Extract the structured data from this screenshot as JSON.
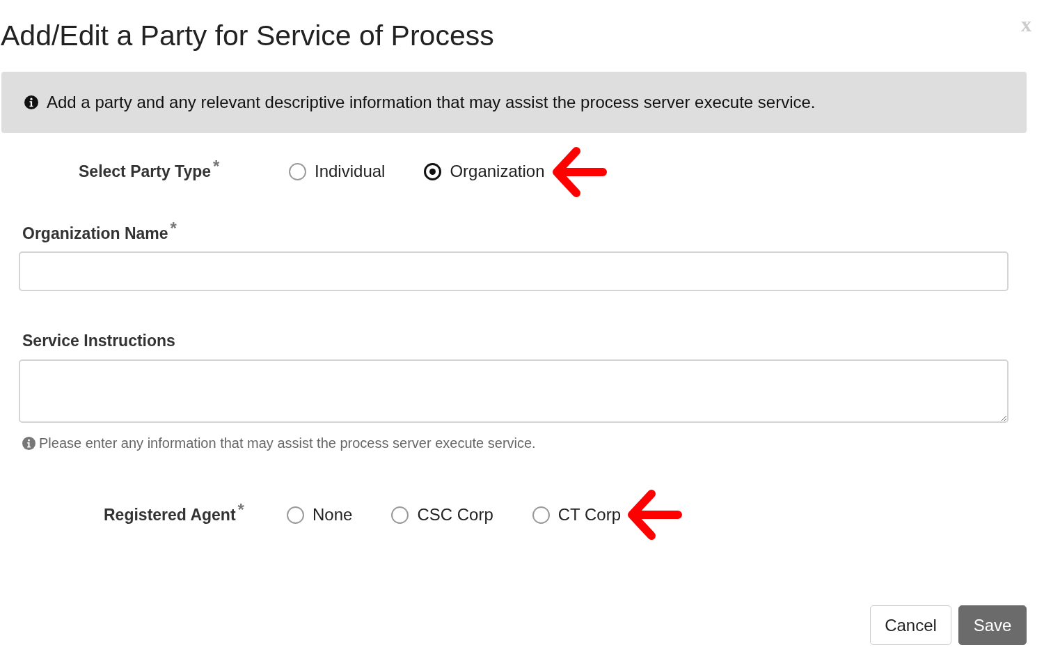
{
  "dialog": {
    "title": "Add/Edit a Party for Service of Process",
    "close": "x"
  },
  "info_banner": {
    "text": "Add a party and any relevant descriptive information that may assist the process server execute service."
  },
  "party_type": {
    "label": "Select Party Type",
    "required_mark": "*",
    "options": [
      {
        "label": "Individual",
        "selected": false
      },
      {
        "label": "Organization",
        "selected": true
      }
    ]
  },
  "organization_name": {
    "label": "Organization Name",
    "required_mark": "*"
  },
  "service_instructions": {
    "label": "Service Instructions",
    "help": "Please enter any information that may assist the process server execute service."
  },
  "registered_agent": {
    "label": "Registered Agent",
    "required_mark": "*",
    "options": [
      {
        "label": "None",
        "selected": false
      },
      {
        "label": "CSC Corp",
        "selected": false
      },
      {
        "label": "CT Corp",
        "selected": false
      }
    ]
  },
  "buttons": [
    {
      "label": "Cancel",
      "kind": "secondary"
    },
    {
      "label": "Save",
      "kind": "primary"
    }
  ]
}
